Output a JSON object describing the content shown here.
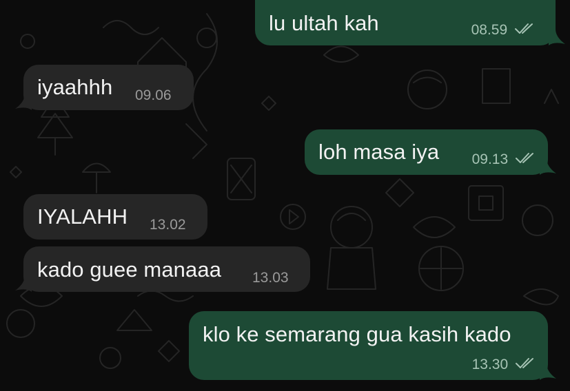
{
  "colors": {
    "background": "#0c0c0c",
    "incoming_bubble": "#262626",
    "outgoing_bubble": "#1d4a35",
    "text": "#f2f2f2",
    "incoming_time": "#9a9a9a",
    "outgoing_time": "#a7c4b5"
  },
  "messages": [
    {
      "direction": "outgoing",
      "text": "lu ultah kah",
      "time": "08.59",
      "status": "read"
    },
    {
      "direction": "incoming",
      "text": "iyaahhh",
      "time": "09.06"
    },
    {
      "direction": "outgoing",
      "text": "loh masa iya",
      "time": "09.13",
      "status": "read"
    },
    {
      "direction": "incoming",
      "text": "IYALAHH",
      "time": "13.02"
    },
    {
      "direction": "incoming",
      "text": "kado guee manaaa",
      "time": "13.03"
    },
    {
      "direction": "outgoing",
      "text": "klo ke semarang gua kasih kado",
      "time": "13.30",
      "status": "read"
    }
  ],
  "icons": {
    "read_receipt": "double-check-icon",
    "wallpaper": "doodle-pattern"
  }
}
